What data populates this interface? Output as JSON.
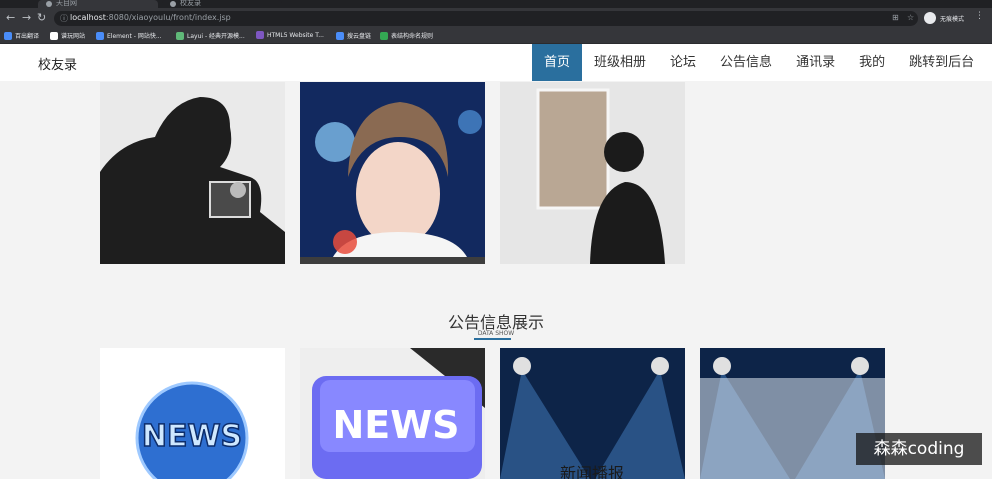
{
  "browser": {
    "tabs": [
      {
        "title": "天目网",
        "active": true
      },
      {
        "title": "校友录",
        "active": false
      }
    ],
    "url_host": "localhost",
    "url_rest": ":8080/xiaoyoulu/front/index.jsp",
    "profile_label": "无痕模式",
    "bookmarks": [
      {
        "label": "百出翻译",
        "color": "#4a8df8"
      },
      {
        "label": "谱玩网站",
        "color": "#ffffff"
      },
      {
        "label": "Element - 网站快...",
        "color": "#4a8df8"
      },
      {
        "label": "Layui - 经典开源模...",
        "color": "#5fb878"
      },
      {
        "label": "HTML5 Website T...",
        "color": "#7e57c2"
      },
      {
        "label": "搜云盘链",
        "color": "#4a8df8"
      },
      {
        "label": "表结构命名规则",
        "color": "#34a853"
      }
    ]
  },
  "site": {
    "logo": "校友录",
    "nav": [
      {
        "label": "首页",
        "active": true
      },
      {
        "label": "班级相册",
        "active": false
      },
      {
        "label": "论坛",
        "active": false
      },
      {
        "label": "公告信息",
        "active": false
      },
      {
        "label": "通讯录",
        "active": false
      },
      {
        "label": "我的",
        "active": false
      },
      {
        "label": "跳转到后台",
        "active": false
      }
    ]
  },
  "section": {
    "title": "公告信息展示",
    "subtitle": "DATA SHOW"
  },
  "news_tiles": [
    {
      "text": "NEWS"
    },
    {
      "text": "NEWS"
    },
    {
      "text": "新闻播报"
    },
    {
      "text": ""
    }
  ],
  "watermark": "森森coding"
}
